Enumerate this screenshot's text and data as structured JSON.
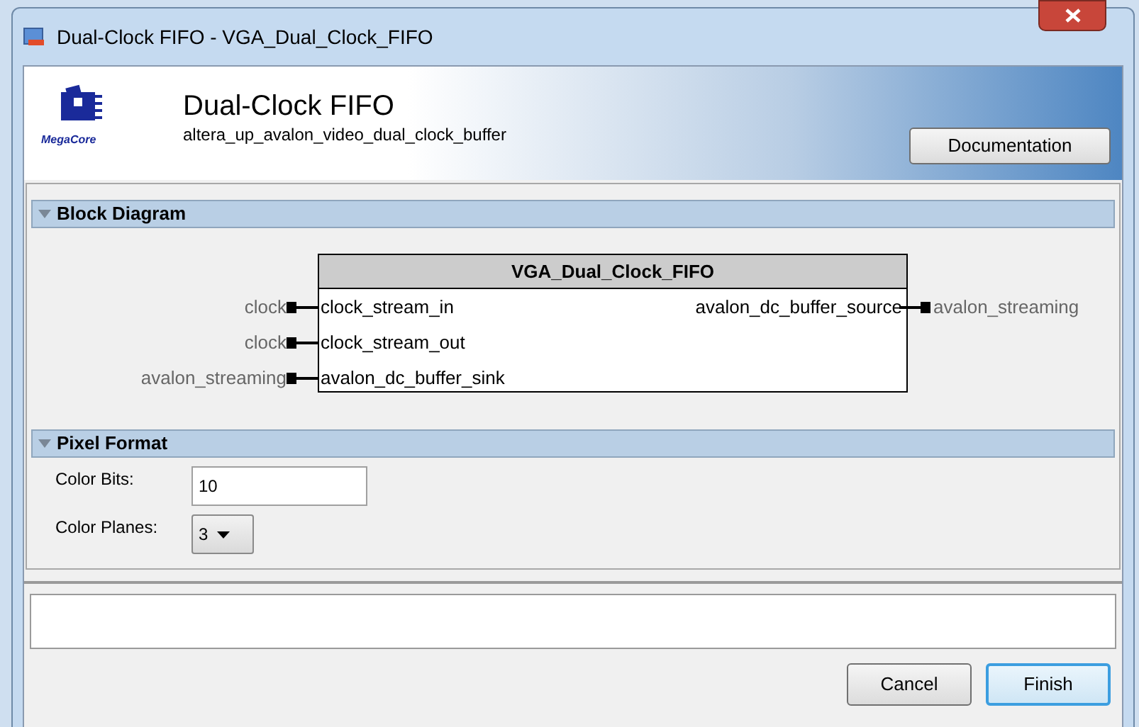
{
  "window": {
    "title": "Dual-Clock FIFO - VGA_Dual_Clock_FIFO"
  },
  "header": {
    "logo_text": "MegaCore",
    "title": "Dual-Clock FIFO",
    "subtitle": "altera_up_avalon_video_dual_clock_buffer",
    "button": "Documentation"
  },
  "block_diagram": {
    "heading": "Block Diagram",
    "expanded": true,
    "component": "VGA_Dual_Clock_FIFO",
    "left_ports": [
      {
        "external": "clock",
        "internal": "clock_stream_in"
      },
      {
        "external": "clock",
        "internal": "clock_stream_out"
      },
      {
        "external": "avalon_streaming",
        "internal": "avalon_dc_buffer_sink"
      }
    ],
    "right_ports": [
      {
        "external": "avalon_streaming",
        "internal": "avalon_dc_buffer_source"
      }
    ]
  },
  "pixel_format": {
    "heading": "Pixel Format",
    "expanded": true,
    "fields": [
      {
        "kind": "text",
        "label": "Color Bits:",
        "value": "10"
      },
      {
        "kind": "dropdown",
        "label": "Color Planes:",
        "value": "3"
      }
    ]
  },
  "buttons": [
    {
      "label": "Cancel",
      "default": false
    },
    {
      "label": "Finish",
      "default": true
    }
  ]
}
